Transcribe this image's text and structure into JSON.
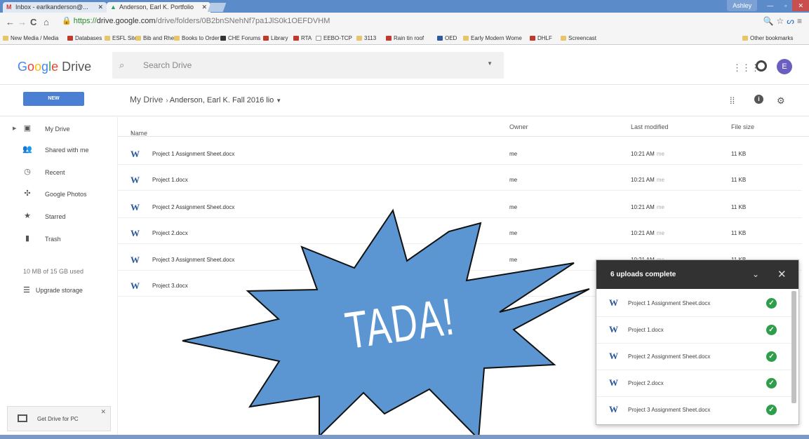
{
  "browser": {
    "tabs": [
      {
        "label": "Inbox - earlkanderson@...",
        "icon": "gmail-icon"
      },
      {
        "label": "Anderson, Earl K. Portfolio",
        "icon": "drive-icon"
      }
    ],
    "window_user": "Ashley",
    "url": {
      "scheme": "https://",
      "host": "drive.google.com",
      "path": "/drive/folders/0B2bnSNehNf7pa1JlS0k1OEFDVHM"
    },
    "bookmarks": [
      "New Media / Media",
      "Databases",
      "ESFL Sites",
      "Bib and Rhet",
      "Books to Order",
      "CHE Forums",
      "Library",
      "RTA",
      "EEBO-TCP",
      "3113",
      "Rain tin roof",
      "OED",
      "Early Modern Wome",
      "DHLF",
      "Screencast"
    ],
    "other_bookmarks": "Other bookmarks"
  },
  "header": {
    "logo_google": [
      "G",
      "o",
      "o",
      "g",
      "l",
      "e"
    ],
    "logo_drive": "Drive",
    "search_placeholder": "Search Drive",
    "avatar_letter": "E"
  },
  "toolbar": {
    "new_label": "NEW",
    "crumb_root": "My Drive",
    "crumb_current": "Anderson, Earl K. Fall 2016 lio"
  },
  "sidebar": {
    "items": [
      {
        "label": "My Drive",
        "icon": "drive-folder-icon"
      },
      {
        "label": "Shared with me",
        "icon": "people-icon"
      },
      {
        "label": "Recent",
        "icon": "clock-icon"
      },
      {
        "label": "Google Photos",
        "icon": "pinwheel-icon"
      },
      {
        "label": "Starred",
        "icon": "star-icon"
      },
      {
        "label": "Trash",
        "icon": "trash-icon"
      }
    ],
    "storage": "10 MB of 15 GB used",
    "upgrade": "Upgrade storage",
    "get_drive": "Get Drive for PC"
  },
  "files": {
    "columns": {
      "name": "Name",
      "owner": "Owner",
      "modified": "Last modified",
      "size": "File size"
    },
    "rows": [
      {
        "name": "Project 1 Assignment Sheet.docx",
        "owner": "me",
        "modified": "10:21 AM",
        "modified_by": "me",
        "size": "11 KB"
      },
      {
        "name": "Project 1.docx",
        "owner": "me",
        "modified": "10:21 AM",
        "modified_by": "me",
        "size": "11 KB"
      },
      {
        "name": "Project 2 Assignment Sheet.docx",
        "owner": "me",
        "modified": "10:21 AM",
        "modified_by": "me",
        "size": "11 KB"
      },
      {
        "name": "Project 2.docx",
        "owner": "me",
        "modified": "10:21 AM",
        "modified_by": "me",
        "size": "11 KB"
      },
      {
        "name": "Project 3 Assignment Sheet.docx",
        "owner": "me",
        "modified": "10:21 AM",
        "modified_by": "me",
        "size": "11 KB"
      },
      {
        "name": "Project 3.docx",
        "owner": "me",
        "modified": "",
        "modified_by": "",
        "size": ""
      }
    ]
  },
  "upload_panel": {
    "title": "6 uploads complete",
    "items": [
      "Project 1 Assignment Sheet.docx",
      "Project 1.docx",
      "Project 2 Assignment Sheet.docx",
      "Project 2.docx",
      "Project 3 Assignment Sheet.docx"
    ]
  },
  "overlay": {
    "text": "TADA!",
    "color": "#5b96d2"
  },
  "colors": {
    "accent": "#4a7fd4",
    "word_icon": "#2b579a",
    "success": "#2e9e4a",
    "panel_header": "#323232"
  }
}
